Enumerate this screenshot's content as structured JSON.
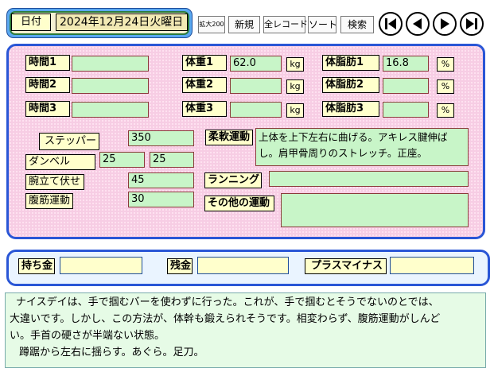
{
  "header": {
    "date_label": "日付",
    "date_value": "2024年12月24日火曜日",
    "buttons": {
      "zoom": "拡大200",
      "new": "新規",
      "all_records": "全レコード",
      "sort": "ソート",
      "search": "検索"
    },
    "nav_icons": [
      "first-record-icon",
      "previous-record-icon",
      "next-record-icon",
      "last-record-icon"
    ]
  },
  "body": {
    "time_rows": [
      {
        "label": "時間1",
        "value": ""
      },
      {
        "label": "時間2",
        "value": ""
      },
      {
        "label": "時間3",
        "value": ""
      }
    ],
    "weight_rows": [
      {
        "label": "体重1",
        "value": "62.0",
        "unit": "kg"
      },
      {
        "label": "体重2",
        "value": "",
        "unit": "kg"
      },
      {
        "label": "体重3",
        "value": "",
        "unit": "kg"
      }
    ],
    "fat_rows": [
      {
        "label": "体脂肪1",
        "value": "16.8",
        "unit": "%"
      },
      {
        "label": "体脂肪2",
        "value": "",
        "unit": "%"
      },
      {
        "label": "体脂肪3",
        "value": "",
        "unit": "%"
      }
    ],
    "stepper": {
      "label": "ステッパー",
      "value": "350"
    },
    "dumbbell": {
      "label": "ダンベル",
      "value1": "25",
      "value2": "25"
    },
    "pushups": {
      "label": "腕立て伏せ",
      "value": "45"
    },
    "situps": {
      "label": "腹筋運動",
      "value": "30"
    },
    "stretching": {
      "label": "柔軟運動",
      "value_line1": "上体を上下左右に曲げる。アキレス腱伸ば",
      "value_line2": "し。肩甲骨周りのストレッチ。正座。"
    },
    "running": {
      "label": "ランニング",
      "value": ""
    },
    "other_exercise": {
      "label": "その他の運動",
      "value": ""
    }
  },
  "money": {
    "cash": {
      "label": "持ち金",
      "value": ""
    },
    "balance": {
      "label": "残金",
      "value": ""
    },
    "plus_minus": {
      "label": "プラスマイナス",
      "value": ""
    }
  },
  "notes": {
    "line1": "ナイスデイは、手で掴むバーを使わずに行った。これが、手で掴むとそうでないのとでは、",
    "line2": "大違いです。しかし、この方法が、体幹も鍛えられそうです。相変わらず、腹筋運動がしんど",
    "line3": "い。手首の硬さが半端ない状態。",
    "line4": "蹲踞から左右に揺らす。あぐら。足刀。"
  },
  "colors": {
    "panel_bg": "#f7cde4",
    "panel_border": "#2a56d6",
    "field_bg": "#c8f5c8",
    "label_bg": "#ffffcc",
    "notes_bg": "#e6fbe6"
  }
}
